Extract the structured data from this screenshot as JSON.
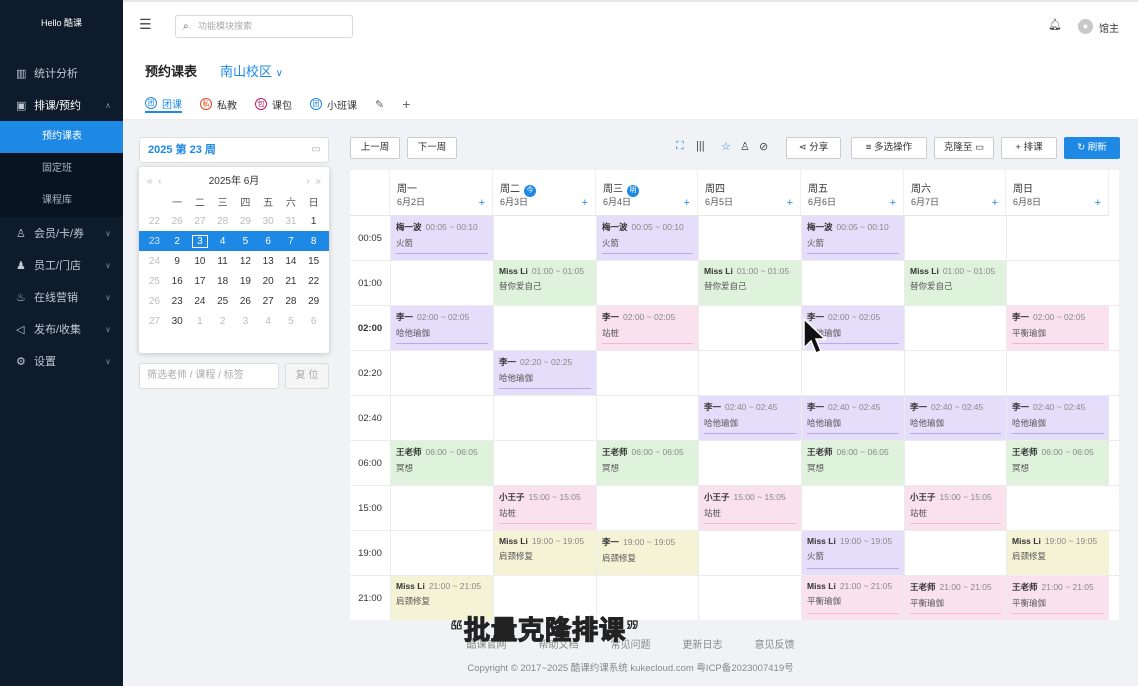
{
  "sidebar": {
    "logo": "Hello 酷课",
    "items": [
      {
        "label": "统计分析",
        "icon": "chart-icon"
      },
      {
        "label": "排课/预约",
        "icon": "calendar-icon",
        "open": true,
        "children": [
          {
            "label": "预约课表",
            "active": true
          },
          {
            "label": "固定班"
          },
          {
            "label": "课程库"
          }
        ]
      },
      {
        "label": "会员/卡/券",
        "icon": "member-icon"
      },
      {
        "label": "员工/门店",
        "icon": "staff-icon"
      },
      {
        "label": "在线营销",
        "icon": "marketing-icon"
      },
      {
        "label": "发布/收集",
        "icon": "publish-icon"
      },
      {
        "label": "设置",
        "icon": "gear-icon"
      }
    ]
  },
  "topbar": {
    "search_placeholder": "功能模块搜索",
    "user": "馆主"
  },
  "page": {
    "title": "预约课表",
    "campus": "南山校区"
  },
  "tabs": [
    {
      "label": "团课",
      "icon_char": "团",
      "color": "#1e88e5"
    },
    {
      "label": "私教",
      "icon_char": "私",
      "color": "#e64a19"
    },
    {
      "label": "课包",
      "icon_char": "包",
      "color": "#c2185b"
    },
    {
      "label": "小班课",
      "icon_char": "团",
      "color": "#1e88e5"
    }
  ],
  "week_picker": "2025 第 23 周",
  "calendar": {
    "year_month": "2025年  6月",
    "weekdays": [
      "一",
      "二",
      "三",
      "四",
      "五",
      "六",
      "日"
    ],
    "rows": [
      [
        "22",
        "26",
        "27",
        "28",
        "29",
        "30",
        "31"
      ],
      [
        "23",
        "2",
        "3",
        "4",
        "5",
        "6",
        "7",
        "8"
      ],
      [
        "24",
        "9",
        "10",
        "11",
        "12",
        "13",
        "14",
        "15"
      ],
      [
        "25",
        "16",
        "17",
        "18",
        "19",
        "20",
        "21",
        "22"
      ],
      [
        "26",
        "23",
        "24",
        "25",
        "26",
        "27",
        "28",
        "29"
      ],
      [
        "27",
        "30",
        "1",
        "2",
        "3",
        "4",
        "5",
        "6"
      ]
    ],
    "first_row": [
      "22",
      "26",
      "27",
      "28",
      "29",
      "30",
      "31",
      "1"
    ]
  },
  "filter": {
    "placeholder": "筛选老师 / 课程 / 标签",
    "reset": "复 位"
  },
  "toolbar": {
    "prev": "上一周",
    "next": "下一周",
    "share": "分享",
    "multi": "多选操作",
    "clone": "克隆至",
    "schedule": "排课",
    "refresh": "刷新"
  },
  "days": [
    {
      "name": "周一",
      "date": "6月2日"
    },
    {
      "name": "周二",
      "date": "6月3日",
      "badge": "今"
    },
    {
      "name": "周三",
      "date": "6月4日",
      "badge": "明"
    },
    {
      "name": "周四",
      "date": "6月5日"
    },
    {
      "name": "周五",
      "date": "6月6日"
    },
    {
      "name": "周六",
      "date": "6月7日"
    },
    {
      "name": "周日",
      "date": "6月8日"
    }
  ],
  "times": [
    "00:05",
    "01:00",
    "02:00",
    "02:20",
    "02:40",
    "06:00",
    "15:00",
    "19:00",
    "21:00"
  ],
  "classes": [
    {
      "row": 0,
      "col": 0,
      "teacher": "梅一波",
      "time": "00:05 ~ 00:10",
      "course": "火箭",
      "color": "purple"
    },
    {
      "row": 0,
      "col": 2,
      "teacher": "梅一波",
      "time": "00:05 ~ 00:10",
      "course": "火箭",
      "color": "purple"
    },
    {
      "row": 0,
      "col": 4,
      "teacher": "梅一波",
      "time": "00:05 ~ 00:10",
      "course": "火箭",
      "color": "purple"
    },
    {
      "row": 1,
      "col": 1,
      "teacher": "Miss Li",
      "time": "01:00 ~ 01:05",
      "course": "替你爱自己",
      "color": "green"
    },
    {
      "row": 1,
      "col": 3,
      "teacher": "Miss Li",
      "time": "01:00 ~ 01:05",
      "course": "替你爱自己",
      "color": "green"
    },
    {
      "row": 1,
      "col": 5,
      "teacher": "Miss Li",
      "time": "01:00 ~ 01:05",
      "course": "替你爱自己",
      "color": "green"
    },
    {
      "row": 2,
      "col": 0,
      "teacher": "李一",
      "time": "02:00 ~ 02:05",
      "course": "哈他瑜伽",
      "color": "purple"
    },
    {
      "row": 2,
      "col": 2,
      "teacher": "李一",
      "time": "02:00 ~ 02:05",
      "course": "站桩",
      "color": "pink"
    },
    {
      "row": 2,
      "col": 4,
      "teacher": "李一",
      "time": "02:00 ~ 02:05",
      "course": "哈他瑜伽",
      "color": "purple"
    },
    {
      "row": 2,
      "col": 6,
      "teacher": "李一",
      "time": "02:00 ~ 02:05",
      "course": "平衡瑜伽",
      "color": "pink"
    },
    {
      "row": 3,
      "col": 1,
      "teacher": "李一",
      "time": "02:20 ~ 02:25",
      "course": "哈他瑜伽",
      "color": "purple"
    },
    {
      "row": 4,
      "col": 3,
      "teacher": "李一",
      "time": "02:40 ~ 02:45",
      "course": "哈他瑜伽",
      "color": "purple"
    },
    {
      "row": 4,
      "col": 4,
      "teacher": "李一",
      "time": "02:40 ~ 02:45",
      "course": "哈他瑜伽",
      "color": "purple"
    },
    {
      "row": 4,
      "col": 5,
      "teacher": "李一",
      "time": "02:40 ~ 02:45",
      "course": "哈他瑜伽",
      "color": "purple"
    },
    {
      "row": 4,
      "col": 6,
      "teacher": "李一",
      "time": "02:40 ~ 02:45",
      "course": "哈他瑜伽",
      "color": "purple"
    },
    {
      "row": 5,
      "col": 0,
      "teacher": "王老师",
      "time": "06:00 ~ 06:05",
      "course": "冥想",
      "color": "green"
    },
    {
      "row": 5,
      "col": 2,
      "teacher": "王老师",
      "time": "06:00 ~ 06:05",
      "course": "冥想",
      "color": "green"
    },
    {
      "row": 5,
      "col": 4,
      "teacher": "王老师",
      "time": "06:00 ~ 06:05",
      "course": "冥想",
      "color": "green"
    },
    {
      "row": 5,
      "col": 6,
      "teacher": "王老师",
      "time": "06:00 ~ 06:05",
      "course": "冥想",
      "color": "green"
    },
    {
      "row": 6,
      "col": 1,
      "teacher": "小王子",
      "time": "15:00 ~ 15:05",
      "course": "站桩",
      "color": "pink"
    },
    {
      "row": 6,
      "col": 3,
      "teacher": "小王子",
      "time": "15:00 ~ 15:05",
      "course": "站桩",
      "color": "pink"
    },
    {
      "row": 6,
      "col": 5,
      "teacher": "小王子",
      "time": "15:00 ~ 15:05",
      "course": "站桩",
      "color": "pink"
    },
    {
      "row": 7,
      "col": 1,
      "teacher": "Miss Li",
      "time": "19:00 ~ 19:05",
      "course": "肩颈修复",
      "color": "yellow"
    },
    {
      "row": 7,
      "col": 2,
      "teacher": "李一",
      "time": "19:00 ~ 19:05",
      "course": "肩颈修复",
      "color": "yellow"
    },
    {
      "row": 7,
      "col": 4,
      "teacher": "Miss Li",
      "time": "19:00 ~ 19:05",
      "course": "火箭",
      "color": "purple"
    },
    {
      "row": 7,
      "col": 6,
      "teacher": "Miss Li",
      "time": "19:00 ~ 19:05",
      "course": "肩颈修复",
      "color": "yellow"
    },
    {
      "row": 8,
      "col": 0,
      "teacher": "Miss Li",
      "time": "21:00 ~ 21:05",
      "course": "肩颈修复",
      "color": "yellow"
    },
    {
      "row": 8,
      "col": 4,
      "teacher": "Miss Li",
      "time": "21:00 ~ 21:05",
      "course": "平衡瑜伽",
      "color": "pink"
    },
    {
      "row": 8,
      "col": 5,
      "teacher": "王老师",
      "time": "21:00 ~ 21:05",
      "course": "平衡瑜伽",
      "color": "pink"
    },
    {
      "row": 8,
      "col": 6,
      "teacher": "王老师",
      "time": "21:00 ~ 21:05",
      "course": "平衡瑜伽",
      "color": "pink"
    }
  ],
  "footer": {
    "links": [
      "酷课官网",
      "帮助文档",
      "常见问题",
      "更新日志",
      "意见反馈"
    ],
    "copyright": "Copyright © 2017~2025 酷课约课系统 kukecloud.com  粤ICP备2023007419号"
  },
  "caption": "“批量克隆排课”"
}
